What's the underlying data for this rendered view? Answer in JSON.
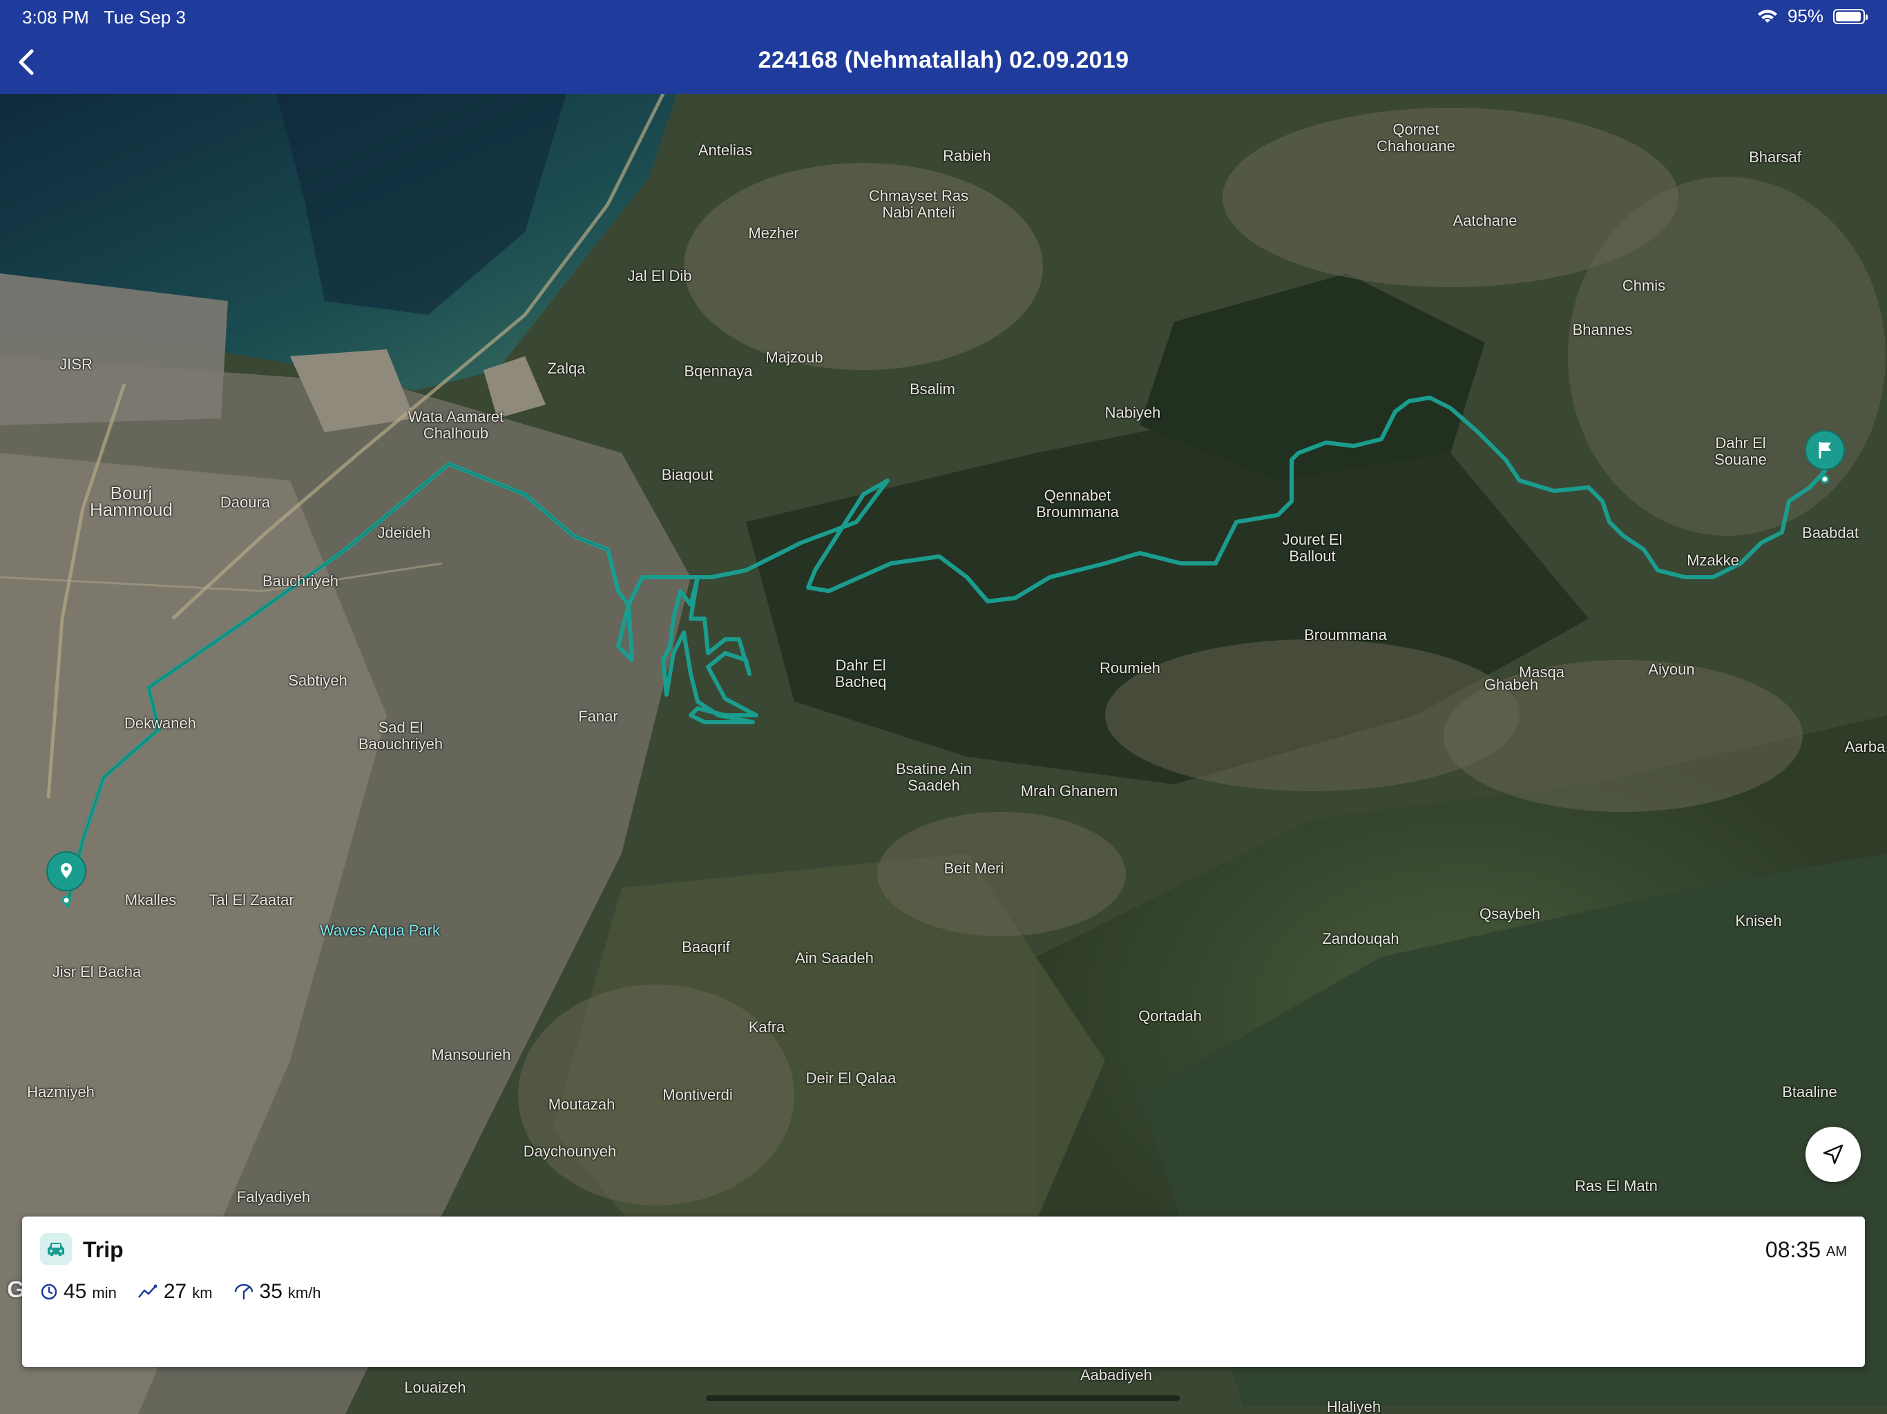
{
  "status_bar": {
    "time": "3:08 PM",
    "date": "Tue Sep 3",
    "battery": "95%",
    "wifi_icon": "wifi-icon",
    "battery_icon": "battery-icon"
  },
  "nav": {
    "title": "224168 (Nehmatallah) 02.09.2019",
    "back_icon": "chevron-left-icon"
  },
  "map": {
    "provider": "Google",
    "route_color": "#1a9d8f",
    "places": [
      {
        "id": "antelias",
        "name": "Antelias"
      },
      {
        "id": "rabieh",
        "name": "Rabieh"
      },
      {
        "id": "chmayset",
        "name": "Chmayset Ras Nabi Anteli"
      },
      {
        "id": "mezher",
        "name": "Mezher"
      },
      {
        "id": "jal-el-dib",
        "name": "Jal El Dib"
      },
      {
        "id": "ornet",
        "name": "Qornet Chahouane"
      },
      {
        "id": "bharsaf",
        "name": "Bharsaf"
      },
      {
        "id": "aatchane",
        "name": "Aatchane"
      },
      {
        "id": "chmis",
        "name": "Chmis"
      },
      {
        "id": "bhannes",
        "name": "Bhannes"
      },
      {
        "id": "jisr",
        "name": "JISR"
      },
      {
        "id": "zalqa",
        "name": "Zalqa"
      },
      {
        "id": "majzoub",
        "name": "Majzoub"
      },
      {
        "id": "bqennaya",
        "name": "Bqennaya"
      },
      {
        "id": "bsalim",
        "name": "Bsalim"
      },
      {
        "id": "nabiyeh",
        "name": "Nabiyeh"
      },
      {
        "id": "wata",
        "name": "Wata Aamaret Chalhoub"
      },
      {
        "id": "bourj",
        "name": "Bourj Hammoud"
      },
      {
        "id": "daoura",
        "name": "Daoura"
      },
      {
        "id": "jdeideh",
        "name": "Jdeideh"
      },
      {
        "id": "biaqout",
        "name": "Biaqout"
      },
      {
        "id": "qennabet",
        "name": "Qennabet Broummana"
      },
      {
        "id": "jouret",
        "name": "Jouret El Ballout"
      },
      {
        "id": "dahr-souane",
        "name": "Dahr El Souane"
      },
      {
        "id": "baabdat",
        "name": "Baabdat"
      },
      {
        "id": "mzakke",
        "name": "Mzakke"
      },
      {
        "id": "bauchriyeh",
        "name": "Bauchriyeh"
      },
      {
        "id": "sabtiyeh",
        "name": "Sabtiyeh"
      },
      {
        "id": "dekwaneh",
        "name": "Dekwaneh"
      },
      {
        "id": "sad",
        "name": "Sad El Baouchriyeh"
      },
      {
        "id": "fanar",
        "name": "Fanar"
      },
      {
        "id": "dahr-bacheq",
        "name": "Dahr El Bacheq"
      },
      {
        "id": "roumieh",
        "name": "Roumieh"
      },
      {
        "id": "broummana",
        "name": "Broummana"
      },
      {
        "id": "ghabeh",
        "name": "Ghabeh"
      },
      {
        "id": "masqa",
        "name": "Masqa"
      },
      {
        "id": "aiyoun",
        "name": "Aiyoun"
      },
      {
        "id": "aarba",
        "name": "Aarba"
      },
      {
        "id": "bsatine",
        "name": "Bsatine Ain Saadeh"
      },
      {
        "id": "mrah",
        "name": "Mrah Ghanem"
      },
      {
        "id": "beit-meri",
        "name": "Beit Meri"
      },
      {
        "id": "mkalles",
        "name": "Mkalles"
      },
      {
        "id": "tal",
        "name": "Tal El Zaatar"
      },
      {
        "id": "waves",
        "name": "Waves Aqua Park"
      },
      {
        "id": "jisr-bacha",
        "name": "Jisr El Bacha"
      },
      {
        "id": "baaqrif",
        "name": "Baaqrif"
      },
      {
        "id": "ain-saadeh",
        "name": "Ain Saadeh"
      },
      {
        "id": "zandouqah",
        "name": "Zandouqah"
      },
      {
        "id": "qsaybeh",
        "name": "Qsaybeh"
      },
      {
        "id": "kniseh",
        "name": "Kniseh"
      },
      {
        "id": "qortadah",
        "name": "Qortadah"
      },
      {
        "id": "kafra",
        "name": "Kafra"
      },
      {
        "id": "mansourieh",
        "name": "Mansourieh"
      },
      {
        "id": "deir",
        "name": "Deir El Qalaa"
      },
      {
        "id": "moutazah",
        "name": "Moutazah"
      },
      {
        "id": "montiverdi",
        "name": "Montiverdi"
      },
      {
        "id": "daychounyeh",
        "name": "Daychounyeh"
      },
      {
        "id": "hazmiyeh",
        "name": "Hazmiyeh"
      },
      {
        "id": "falyadiyeh",
        "name": "Falyadiyeh"
      },
      {
        "id": "btaaline",
        "name": "Btaaline"
      },
      {
        "id": "ras-matn",
        "name": "Ras El Matn"
      },
      {
        "id": "aabadiyeh",
        "name": "Aabadiyeh"
      },
      {
        "id": "louaizeh",
        "name": "Louaizeh"
      },
      {
        "id": "hlaliyeh",
        "name": "Hlaliyeh"
      }
    ],
    "start_pin_icon": "location-pin-icon",
    "end_pin_icon": "flag-icon",
    "locate_icon": "navigation-arrow-icon"
  },
  "trip": {
    "label": "Trip",
    "car_icon": "car-icon",
    "start_time": "08:35",
    "start_ampm": "AM",
    "duration_value": "45",
    "duration_unit": "min",
    "duration_icon": "clock-icon",
    "distance_value": "27",
    "distance_unit": "km",
    "distance_icon": "trend-line-icon",
    "speed_value": "35",
    "speed_unit": "km/h",
    "speed_icon": "speedometer-icon"
  }
}
